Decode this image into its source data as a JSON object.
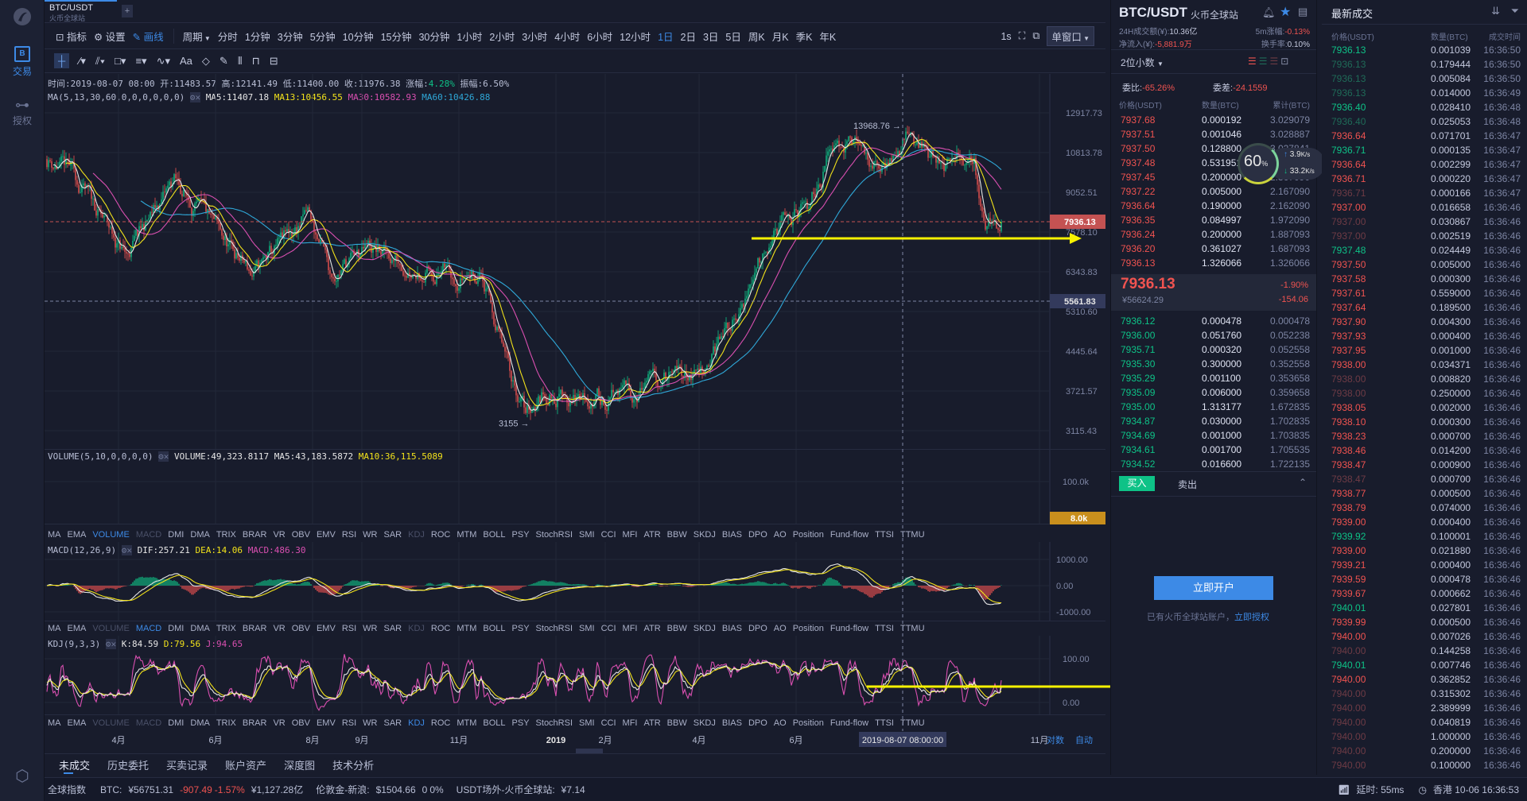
{
  "sidebar": {
    "trade_label": "交易",
    "auth_label": "授权"
  },
  "tab": {
    "symbol": "BTC/USDT",
    "exchange": "火币全球站",
    "add": "+"
  },
  "toolbar": {
    "indicator": "指标",
    "settings": "设置",
    "draw": "画线",
    "period": "周期",
    "periods": [
      "分时",
      "1分钟",
      "3分钟",
      "5分钟",
      "10分钟",
      "15分钟",
      "30分钟",
      "1小时",
      "2小时",
      "3小时",
      "4小时",
      "6小时",
      "12小时",
      "1日",
      "2日",
      "3日",
      "5日",
      "周K",
      "月K",
      "季K",
      "年K"
    ],
    "active_period": "1日",
    "interval": "1s",
    "window_mode": "单窗口"
  },
  "info": {
    "time": "时间:2019-08-07 08:00",
    "open": "开:11483.57",
    "high": "高:12141.49",
    "low": "低:11400.00",
    "close": "收:11976.38",
    "change_label": "涨幅:",
    "change": "4.28%",
    "amp": "振幅:6.50%",
    "ma_title": "MA(5,13,30,60,0,0,0,0,0,0)",
    "ma5": "MA5:11407.18",
    "ma13": "MA13:10456.55",
    "ma30": "MA30:10582.93",
    "ma60": "MA60:10426.88"
  },
  "volume": {
    "title": "VOLUME(5,10,0,0,0,0)",
    "vol": "VOLUME:49,323.8117",
    "ma5": "MA5:43,183.5872",
    "ma10": "MA10:36,115.5089",
    "tag": "8.0k"
  },
  "macd": {
    "title": "MACD(12,26,9)",
    "dif": "DIF:257.21",
    "dea": "DEA:14.06",
    "macd": "MACD:486.30"
  },
  "kdj": {
    "title": "KDJ(9,3,3)",
    "k": "K:84.59",
    "d": "D:79.56",
    "j": "J:94.65"
  },
  "indicator_tabs": [
    "MA",
    "EMA",
    "VOLUME",
    "MACD",
    "DMI",
    "DMA",
    "TRIX",
    "BRAR",
    "VR",
    "OBV",
    "EMV",
    "RSI",
    "WR",
    "SAR",
    "KDJ",
    "ROC",
    "MTM",
    "BOLL",
    "PSY",
    "StochRSI",
    "SMI",
    "CCI",
    "MFI",
    "ATR",
    "BBW",
    "SKDJ",
    "BIAS",
    "DPO",
    "AO",
    "Position",
    "Fund-flow",
    "TTSI",
    "TTMU"
  ],
  "chart_data": {
    "type": "candlestick",
    "price_axis": [
      "12917.73",
      "10813.78",
      "9052.51",
      "7578.10",
      "6343.83",
      "5310.60",
      "4445.64",
      "3721.57",
      "3115.43"
    ],
    "last_price": "7936.13",
    "marker_price": "5561.83",
    "high_mark": "13968.76 →",
    "low_mark": "3155 →",
    "price_anchors": [
      [
        0,
        10500
      ],
      [
        14,
        10000
      ],
      [
        50,
        6800
      ],
      [
        80,
        9500
      ],
      [
        130,
        6200
      ],
      [
        164,
        8200
      ],
      [
        178,
        6300
      ],
      [
        203,
        7000
      ],
      [
        240,
        6400
      ],
      [
        273,
        6300
      ],
      [
        289,
        4200
      ],
      [
        301,
        3400
      ],
      [
        313,
        3700
      ],
      [
        350,
        3600
      ],
      [
        387,
        3900
      ],
      [
        411,
        4100
      ],
      [
        436,
        5300
      ],
      [
        454,
        7600
      ],
      [
        478,
        8300
      ],
      [
        497,
        12000
      ],
      [
        509,
        11000
      ],
      [
        525,
        10000
      ],
      [
        540,
        11800
      ],
      [
        565,
        10200
      ],
      [
        583,
        10400
      ],
      [
        590,
        7900
      ],
      [
        600,
        7936.13
      ]
    ],
    "volume_axis": [
      "100.0k"
    ],
    "macd_axis": [
      "1000.00",
      "0.00",
      "-1000.00"
    ],
    "kdj_axis": [
      "100.00",
      "0.00"
    ],
    "time_axis": [
      {
        "label": "4月",
        "day": 45
      },
      {
        "label": "6月",
        "day": 106
      },
      {
        "label": "8月",
        "day": 167
      },
      {
        "label": "9月",
        "day": 198
      },
      {
        "label": "11月",
        "day": 259
      },
      {
        "label": "2019",
        "day": 320
      },
      {
        "label": "2月",
        "day": 351
      },
      {
        "label": "4月",
        "day": 410
      },
      {
        "label": "6月",
        "day": 471
      },
      {
        "label": "11月",
        "day": 624
      }
    ],
    "crosshair_day": 538,
    "crosshair_label": "2019-08-07 08:00:00",
    "log_label": "对数",
    "auto_label": "自动"
  },
  "bottom_tabs": [
    "未成交",
    "历史委托",
    "买卖记录",
    "账户资产",
    "深度图",
    "技术分析"
  ],
  "orderbook": {
    "symbol": "BTC/USDT",
    "exchange": "火币全球站",
    "vol24_label": "24H成交额(¥):",
    "vol24": "10.36亿",
    "chg5_label": "5m涨幅:",
    "chg5": "-0.13%",
    "inflow_label": "净流入(¥):",
    "inflow": "-5,881.9万",
    "turnover_label": "换手率:",
    "turnover": "0.10%",
    "decimals": "2位小数",
    "ratio_label": "委比:",
    "ratio": "-65.26%",
    "diff_label": "委差:",
    "diff": "-24.1559",
    "headers": [
      "价格(USDT)",
      "数量(BTC)",
      "累计(BTC)"
    ],
    "asks": [
      [
        "7937.68",
        "0.000192",
        "3.029079"
      ],
      [
        "7937.51",
        "0.001046",
        "3.028887"
      ],
      [
        "7937.50",
        "0.128800",
        "3.027841"
      ],
      [
        "7937.48",
        "0.531951",
        "2.899041"
      ],
      [
        "7937.45",
        "0.200000",
        "2.367090"
      ],
      [
        "7937.22",
        "0.005000",
        "2.167090"
      ],
      [
        "7936.64",
        "0.190000",
        "2.162090"
      ],
      [
        "7936.35",
        "0.084997",
        "1.972090"
      ],
      [
        "7936.24",
        "0.200000",
        "1.887093"
      ],
      [
        "7936.20",
        "0.361027",
        "1.687093"
      ],
      [
        "7936.13",
        "1.326066",
        "1.326066"
      ]
    ],
    "last": "7936.13",
    "last_cny": "¥56624.29",
    "last_pct": "-1.90%",
    "last_chg": "-154.06",
    "bids": [
      [
        "7936.12",
        "0.000478",
        "0.000478"
      ],
      [
        "7936.00",
        "0.051760",
        "0.052238"
      ],
      [
        "7935.71",
        "0.000320",
        "0.052558"
      ],
      [
        "7935.30",
        "0.300000",
        "0.352558"
      ],
      [
        "7935.29",
        "0.001100",
        "0.353658"
      ],
      [
        "7935.09",
        "0.006000",
        "0.359658"
      ],
      [
        "7935.00",
        "1.313177",
        "1.672835"
      ],
      [
        "7934.87",
        "0.030000",
        "1.702835"
      ],
      [
        "7934.69",
        "0.001000",
        "1.703835"
      ],
      [
        "7934.61",
        "0.001700",
        "1.705535"
      ],
      [
        "7934.52",
        "0.016600",
        "1.722135"
      ]
    ],
    "buy": "买入",
    "sell": "卖出",
    "open_account": "立即开户",
    "has_account": "已有火币全球站账户，",
    "authorize": "立即授权"
  },
  "speed": {
    "percent": "60",
    "pct_sign": "%",
    "up": "3.9",
    "down": "33.2",
    "unit": "K/s"
  },
  "trades": {
    "title": "最新成交",
    "headers": [
      "价格(USDT)",
      "数量(BTC)",
      "成交时间"
    ],
    "rows": [
      [
        "7936.13",
        "0.001039",
        "16:36:50",
        "buy"
      ],
      [
        "7936.13",
        "0.179444",
        "16:36:50",
        "buy-dim"
      ],
      [
        "7936.13",
        "0.005084",
        "16:36:50",
        "buy-dim"
      ],
      [
        "7936.13",
        "0.014000",
        "16:36:49",
        "buy-dim"
      ],
      [
        "7936.40",
        "0.028410",
        "16:36:48",
        "buy"
      ],
      [
        "7936.40",
        "0.025053",
        "16:36:48",
        "buy-dim"
      ],
      [
        "7936.64",
        "0.071701",
        "16:36:47",
        "sell"
      ],
      [
        "7936.71",
        "0.000135",
        "16:36:47",
        "buy"
      ],
      [
        "7936.64",
        "0.002299",
        "16:36:47",
        "sell"
      ],
      [
        "7936.71",
        "0.000220",
        "16:36:47",
        "sell"
      ],
      [
        "7936.71",
        "0.000166",
        "16:36:47",
        "sell-dim"
      ],
      [
        "7937.00",
        "0.016658",
        "16:36:46",
        "sell"
      ],
      [
        "7937.00",
        "0.030867",
        "16:36:46",
        "sell-dim"
      ],
      [
        "7937.00",
        "0.002519",
        "16:36:46",
        "sell-dim"
      ],
      [
        "7937.48",
        "0.024449",
        "16:36:46",
        "buy"
      ],
      [
        "7937.50",
        "0.005000",
        "16:36:46",
        "sell"
      ],
      [
        "7937.58",
        "0.000300",
        "16:36:46",
        "sell"
      ],
      [
        "7937.61",
        "0.559000",
        "16:36:46",
        "sell"
      ],
      [
        "7937.64",
        "0.189500",
        "16:36:46",
        "sell"
      ],
      [
        "7937.90",
        "0.004300",
        "16:36:46",
        "sell"
      ],
      [
        "7937.93",
        "0.000400",
        "16:36:46",
        "sell"
      ],
      [
        "7937.95",
        "0.001000",
        "16:36:46",
        "sell"
      ],
      [
        "7938.00",
        "0.034371",
        "16:36:46",
        "sell"
      ],
      [
        "7938.00",
        "0.008820",
        "16:36:46",
        "sell-dim"
      ],
      [
        "7938.00",
        "0.250000",
        "16:36:46",
        "sell-dim"
      ],
      [
        "7938.05",
        "0.002000",
        "16:36:46",
        "sell"
      ],
      [
        "7938.10",
        "0.000300",
        "16:36:46",
        "sell"
      ],
      [
        "7938.23",
        "0.000700",
        "16:36:46",
        "sell"
      ],
      [
        "7938.46",
        "0.014200",
        "16:36:46",
        "sell"
      ],
      [
        "7938.47",
        "0.000900",
        "16:36:46",
        "sell"
      ],
      [
        "7938.47",
        "0.000700",
        "16:36:46",
        "sell-dim"
      ],
      [
        "7938.77",
        "0.000500",
        "16:36:46",
        "sell"
      ],
      [
        "7938.79",
        "0.074000",
        "16:36:46",
        "sell"
      ],
      [
        "7939.00",
        "0.000400",
        "16:36:46",
        "sell"
      ],
      [
        "7939.92",
        "0.100001",
        "16:36:46",
        "buy"
      ],
      [
        "7939.00",
        "0.021880",
        "16:36:46",
        "sell"
      ],
      [
        "7939.21",
        "0.000400",
        "16:36:46",
        "sell"
      ],
      [
        "7939.59",
        "0.000478",
        "16:36:46",
        "sell"
      ],
      [
        "7939.67",
        "0.000662",
        "16:36:46",
        "sell"
      ],
      [
        "7940.01",
        "0.027801",
        "16:36:46",
        "buy"
      ],
      [
        "7939.99",
        "0.000500",
        "16:36:46",
        "sell"
      ],
      [
        "7940.00",
        "0.007026",
        "16:36:46",
        "sell"
      ],
      [
        "7940.00",
        "0.144258",
        "16:36:46",
        "sell-dim"
      ],
      [
        "7940.01",
        "0.007746",
        "16:36:46",
        "buy"
      ],
      [
        "7940.00",
        "0.362852",
        "16:36:46",
        "sell"
      ],
      [
        "7940.00",
        "0.315302",
        "16:36:46",
        "sell-dim"
      ],
      [
        "7940.00",
        "2.389999",
        "16:36:46",
        "sell-dim"
      ],
      [
        "7940.00",
        "0.040819",
        "16:36:46",
        "sell-dim"
      ],
      [
        "7940.00",
        "1.000000",
        "16:36:46",
        "sell-dim"
      ],
      [
        "7940.00",
        "0.200000",
        "16:36:46",
        "sell-dim"
      ],
      [
        "7940.00",
        "0.100000",
        "16:36:46",
        "sell-dim"
      ]
    ]
  },
  "status": {
    "index": "全球指数",
    "btc_label": "BTC:",
    "btc_price": "¥56751.31",
    "btc_chg": "-907.49",
    "btc_pct": "-1.57%",
    "btc_vol": "¥1,127.28亿",
    "gold_label": "伦敦金-新浪:",
    "gold_price": "$1504.66",
    "gold_chg": "0",
    "gold_pct": "0%",
    "usdt_label": "USDT场外-火币全球站:",
    "usdt_price": "¥7.14",
    "latency": "延时: 55ms",
    "clock": "香港 10-06 16:36:53"
  },
  "colors": {
    "up": "#0ec287",
    "down": "#ef5350",
    "accent": "#3d8ae6",
    "ma5": "#e6e6e6",
    "ma13": "#f2e21b",
    "ma30": "#d94fb0",
    "ma60": "#2fa8d8"
  }
}
